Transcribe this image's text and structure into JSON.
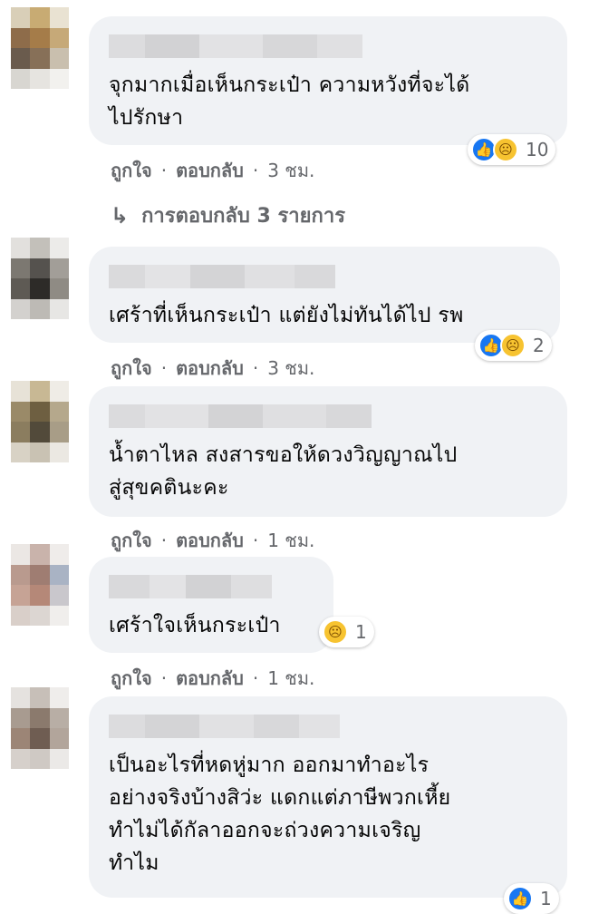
{
  "colors": {
    "bubble": "#f0f2f5",
    "meta_text": "#65676b",
    "like_blue": "#1877f2",
    "sad_yellow": "#f7c330"
  },
  "actions": {
    "like_label": "ถูกใจ",
    "separator": "·",
    "reply_label": "ตอบกลับ"
  },
  "comments": [
    {
      "text": "จุกมากเมื่อเห็นกระเป๋า ความหวังที่จะได้\nไปรักษา",
      "reactions": [
        "like-icon",
        "sad-icon"
      ],
      "reaction_count": "10",
      "time": "3 ชม."
    },
    {
      "text": "เศร้าที่เห็นกระเป๋า แต่ยังไม่ทันได้ไป รพ",
      "reactions": [
        "like-icon",
        "sad-icon"
      ],
      "reaction_count": "2",
      "time": "3 ชม."
    },
    {
      "text": "น้ำตาไหล สงสารขอให้ดวงวิญญาณไป\nสู่สุขคตินะคะ",
      "reactions": [],
      "reaction_count": "",
      "time": "1 ชม."
    },
    {
      "text": "เศร้าใจเห็นกระเป๋า",
      "reactions": [
        "sad-icon"
      ],
      "reaction_count": "1",
      "time": "1 ชม."
    },
    {
      "text": "เป็นอะไรที่หดหู่มาก ออกมาทำอะไร\nอย่างจริงบ้างสิว่ะ แดกแต่ภาษีพวกเหี้ย\nทำไม่ได้กัลาออกจะถ่วงความเจริญ\nทำไม",
      "reactions": [
        "like-icon"
      ],
      "reaction_count": "1",
      "time": ""
    }
  ],
  "replies_link": {
    "label": "การตอบกลับ 3 รายการ"
  }
}
